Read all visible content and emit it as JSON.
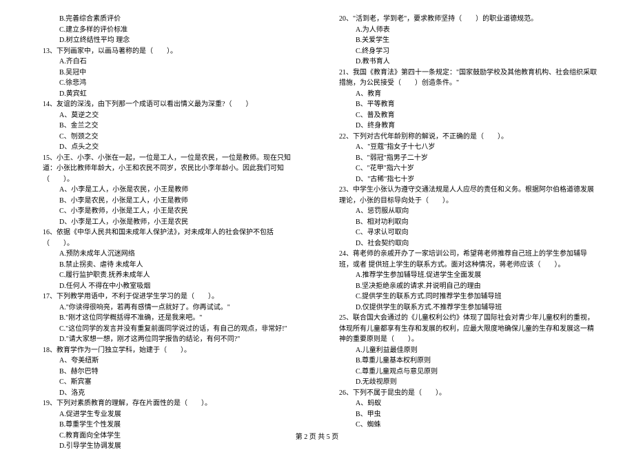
{
  "footer": "第 2 页 共 5 页",
  "left_column": [
    {
      "type": "option",
      "text": "B.完善综合素质评价"
    },
    {
      "type": "option",
      "text": "C.建立多样的评价标准"
    },
    {
      "type": "option",
      "text": "D.树立终结性平均 理念"
    },
    {
      "type": "question",
      "text": "13、下列画家中，以画马著称的是（　　）。"
    },
    {
      "type": "option",
      "text": "A.齐白石"
    },
    {
      "type": "option",
      "text": "B.吴冠中"
    },
    {
      "type": "option",
      "text": "C.徐悲鸿"
    },
    {
      "type": "option",
      "text": "D.黄宾虹"
    },
    {
      "type": "question",
      "text": "14、友谊的深浅，由下列那一个成语可以看出情义最为深重?（　　）"
    },
    {
      "type": "option",
      "text": "A、莫逆之交"
    },
    {
      "type": "option",
      "text": "B、金兰之交"
    },
    {
      "type": "option",
      "text": "C、刎颈之交"
    },
    {
      "type": "option",
      "text": "D、点头之交"
    },
    {
      "type": "question",
      "text": "15、小王、小李、小张在一起，一位是工人，一位是农民，一位是教师。现在只知道：小张比教师年龄大，小王和农民不同岁，农民比小李年龄小。因此我们可知（　　）。"
    },
    {
      "type": "option",
      "text": "A、小李是工人，小张是农民，小王是教师"
    },
    {
      "type": "option",
      "text": "B、小李是农民，小张是工人，小王是教师"
    },
    {
      "type": "option",
      "text": "C、小李是教师，小张是工人，小王是农民"
    },
    {
      "type": "option",
      "text": "D、小李是工人，小张是教师，小王是农民"
    },
    {
      "type": "question",
      "text": "16、依据《中华人民共和国未成年人保护法》，对未成年人的社会保护不包括（　　）。"
    },
    {
      "type": "option",
      "text": "A.预防未成年人沉迷网络"
    },
    {
      "type": "option",
      "text": "B.禁止拐卖、虐待 未成年人"
    },
    {
      "type": "option",
      "text": "C.履行监护职责.抚养未成年人"
    },
    {
      "type": "option",
      "text": "D.任何人 不得在中小教室吸烟"
    },
    {
      "type": "question",
      "text": "17、下列教学用语中，不利于促进学生学习的是（　　）。"
    },
    {
      "type": "option",
      "text": "A.\"你读得很响亮，若再有感情一点就好了。你再试试。\""
    },
    {
      "type": "option",
      "text": "B.\"刚才这位同学概括得不准确，还是我来吧。\""
    },
    {
      "type": "option",
      "text": "C.\"这位同学的发言并没有重复前面同学说过的话，有自己的观点，非常好!\""
    },
    {
      "type": "option",
      "text": "D.\"请大家想一想，刚才这两位同学报告的结论，有何不同?\""
    },
    {
      "type": "question",
      "text": "18、教育学作为一门独立学科，始建于（　　）。"
    },
    {
      "type": "option",
      "text": "A、夸美纽斯"
    },
    {
      "type": "option",
      "text": "B、赫尔巴特"
    },
    {
      "type": "option",
      "text": "C、斯宾塞"
    },
    {
      "type": "option",
      "text": "D、洛克"
    },
    {
      "type": "question",
      "text": "19、下列对素质教育的理解，存在片面性的是（　　）。"
    },
    {
      "type": "option",
      "text": "A.促进学生专业发展"
    },
    {
      "type": "option",
      "text": "B.尊重学生个性发展"
    },
    {
      "type": "option",
      "text": "C.教育面向全体学生"
    },
    {
      "type": "option",
      "text": "D.引导学生协调发展"
    }
  ],
  "right_column": [
    {
      "type": "question",
      "text": "20、\"活到老，学到老\"，要求教师坚持（　　）的职业道德规范。"
    },
    {
      "type": "option",
      "text": "A.为人师表"
    },
    {
      "type": "option",
      "text": "B.关爱学生"
    },
    {
      "type": "option",
      "text": "C.终身学习"
    },
    {
      "type": "option",
      "text": "D.教书育人"
    },
    {
      "type": "question",
      "text": "21、我国《教育法》第四十一条规定：\"国家鼓励学校及其他教育机构、社会组织采取措施，为公民接受（　　）创造条件。\""
    },
    {
      "type": "option",
      "text": "A、教育"
    },
    {
      "type": "option",
      "text": "B、平等教育"
    },
    {
      "type": "option",
      "text": "C、普及教育"
    },
    {
      "type": "option",
      "text": "D、终身教育"
    },
    {
      "type": "question",
      "text": "22、下列对古代年龄别称的解说，不正确的是（　　）。"
    },
    {
      "type": "option",
      "text": "A、\"豆蔻\"指女子十七八岁"
    },
    {
      "type": "option",
      "text": "B、\"弱冠\"指男子二十岁"
    },
    {
      "type": "option",
      "text": "C、\"花甲\"指六十岁"
    },
    {
      "type": "option",
      "text": "D、\"古稀\"指七十岁"
    },
    {
      "type": "question",
      "text": "23、中学生小张认为遵守交通法规是人人应尽的责任和义务。根据阿尔伯格道德发展理论，小张的目标导向处于（　　）。"
    },
    {
      "type": "option",
      "text": "A、惩罚服从取向"
    },
    {
      "type": "option",
      "text": "B、相对功利取向"
    },
    {
      "type": "option",
      "text": "C、寻求认可取向"
    },
    {
      "type": "option",
      "text": "D、社会契约取向"
    },
    {
      "type": "question",
      "text": "24、蒋老师的亲戚开办了一家培训公司，希望蒋老师推荐自己班上的学生参加辅导班，或者 提供班上学生的联系方式。面对这种情况，蒋老师应该（　　）。"
    },
    {
      "type": "option",
      "text": "A.推荐学生参加辅导班.促进学生全面发展"
    },
    {
      "type": "option",
      "text": "B.坚决拒绝亲戚的请求.并说明自己的理由"
    },
    {
      "type": "option",
      "text": "C.提供学生的联系方式.同时推荐学生参加辅导班"
    },
    {
      "type": "option",
      "text": "D.仅提供学生的联系方式.不推荐学生参加辅导班"
    },
    {
      "type": "question",
      "text": "25、联合国大会通过的《儿童权利公约》体现了国际社会对青少年儿童权利的重视，体现所有儿童都享有生存和发展的权利，应最大限度地确保儿童的生存和发展这一精神的重要原则是（　　）。"
    },
    {
      "type": "option",
      "text": "A.儿童利益最佳原则"
    },
    {
      "type": "option",
      "text": "B.尊重儿童基本权利原则"
    },
    {
      "type": "option",
      "text": "C.尊重儿童观点与意见原则"
    },
    {
      "type": "option",
      "text": "D.无歧视原则"
    },
    {
      "type": "question",
      "text": "26、下列不属于昆虫的是（　　）。"
    },
    {
      "type": "option",
      "text": "A、蚂蚁"
    },
    {
      "type": "option",
      "text": "B、甲虫"
    },
    {
      "type": "option",
      "text": "C、蜘蛛"
    }
  ]
}
